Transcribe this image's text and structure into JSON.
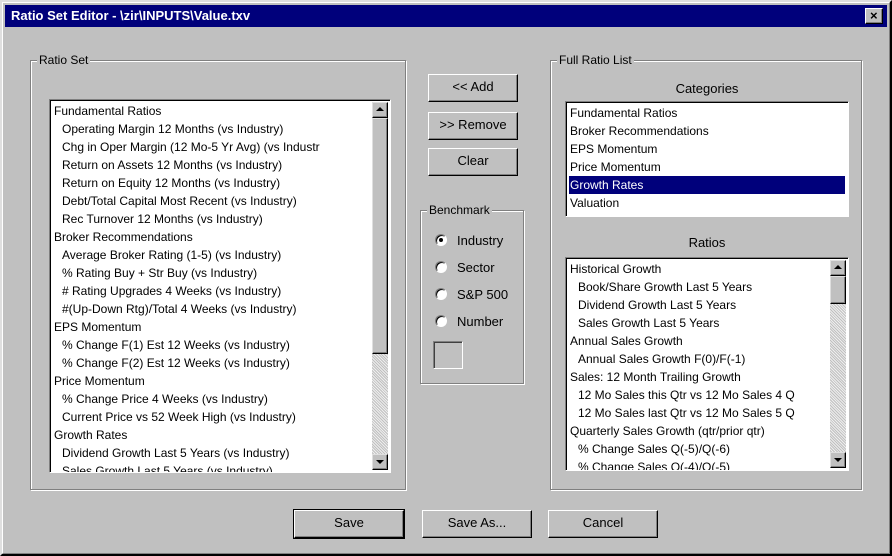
{
  "window": {
    "title": "Ratio Set Editor - \\zir\\INPUTS\\Value.txv",
    "close_glyph": "×"
  },
  "ratio_set": {
    "label": "Ratio Set",
    "items": [
      {
        "text": "Fundamental Ratios",
        "indent": false
      },
      {
        "text": "Operating Margin   12 Months (vs Industry)",
        "indent": true
      },
      {
        "text": "Chg in Oper Margin  (12 Mo-5 Yr Avg) (vs Industr",
        "indent": true
      },
      {
        "text": "Return on Assets  12 Months (vs Industry)",
        "indent": true
      },
      {
        "text": "Return on Equity  12 Months (vs Industry)",
        "indent": true
      },
      {
        "text": "Debt/Total Capital  Most Recent  (vs Industry)",
        "indent": true
      },
      {
        "text": "Rec Turnover    12 Months (vs Industry)",
        "indent": true
      },
      {
        "text": "Broker Recommendations",
        "indent": false
      },
      {
        "text": "Average Broker  Rating (1-5) (vs Industry)",
        "indent": true
      },
      {
        "text": "% Rating  Buy + Str Buy (vs Industry)",
        "indent": true
      },
      {
        "text": "# Rating Upgrades  4 Weeks (vs Industry)",
        "indent": true
      },
      {
        "text": "#(Up-Down Rtg)/Total   4 Weeks (vs Industry)",
        "indent": true
      },
      {
        "text": "EPS Momentum",
        "indent": false
      },
      {
        "text": "% Change F(1) Est  12 Weeks (vs Industry)",
        "indent": true
      },
      {
        "text": "% Change F(2) Est  12 Weeks (vs Industry)",
        "indent": true
      },
      {
        "text": "Price Momentum",
        "indent": false
      },
      {
        "text": "% Change Price  4 Weeks (vs Industry)",
        "indent": true
      },
      {
        "text": "Current Price vs  52 Week High (vs Industry)",
        "indent": true
      },
      {
        "text": "Growth Rates",
        "indent": false
      },
      {
        "text": "Dividend Growth  Last 5 Years (vs Industry)",
        "indent": true
      },
      {
        "text": "Sales Growth  Last 5 Years (vs Industry)",
        "indent": true
      }
    ],
    "scroll_position": 0.0
  },
  "buttons": {
    "add": "<< Add",
    "remove": ">> Remove",
    "clear": "Clear",
    "save": "Save",
    "save_as": "Save As...",
    "cancel": "Cancel"
  },
  "benchmark": {
    "label": "Benchmark",
    "options": [
      "Industry",
      "Sector",
      "S&P 500",
      "Number"
    ],
    "selected": "Industry",
    "number_value": ""
  },
  "full_ratio_list": {
    "label": "Full Ratio List",
    "categories_label": "Categories",
    "categories": [
      "Fundamental Ratios",
      "Broker Recommendations",
      "EPS Momentum",
      "Price Momentum",
      "Growth Rates",
      "Valuation"
    ],
    "selected_category": "Growth Rates",
    "ratios_label": "Ratios",
    "ratios": [
      {
        "text": "Historical Growth",
        "indent": false
      },
      {
        "text": "Book/Share Growth  Last 5 Years",
        "indent": true
      },
      {
        "text": "Dividend Growth  Last 5 Years",
        "indent": true
      },
      {
        "text": "Sales Growth  Last 5 Years",
        "indent": true
      },
      {
        "text": "Annual Sales Growth",
        "indent": false
      },
      {
        "text": "Annual Sales Growth  F(0)/F(-1)",
        "indent": true
      },
      {
        "text": "Sales: 12 Month Trailing Growth",
        "indent": false
      },
      {
        "text": "12 Mo Sales this Qtr vs  12 Mo Sales 4 Q",
        "indent": true
      },
      {
        "text": "12 Mo Sales last Qtr vs  12 Mo Sales 5 Q",
        "indent": true
      },
      {
        "text": "Quarterly Sales Growth (qtr/prior qtr)",
        "indent": false
      },
      {
        "text": "% Change Sales  Q(-5)/Q(-6)",
        "indent": true
      },
      {
        "text": "% Change Sales  Q(-4)/Q(-5)",
        "indent": true
      }
    ]
  }
}
